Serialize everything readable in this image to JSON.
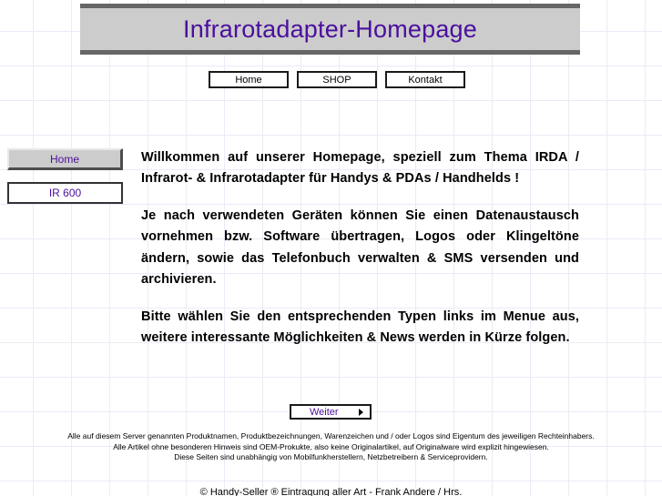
{
  "header": {
    "title": "Infrarotadapter-Homepage",
    "bg_color": "#cccccc",
    "border_color": "#666666",
    "title_color": "#4b0f9e"
  },
  "topnav": {
    "items": [
      {
        "label": "Home"
      },
      {
        "label": "SHOP"
      },
      {
        "label": "Kontakt"
      }
    ]
  },
  "sidebar": {
    "items": [
      {
        "label": "Home",
        "state": "active"
      },
      {
        "label": "IR 600",
        "state": "plain"
      }
    ]
  },
  "main": {
    "paragraphs": [
      "Willkommen auf unserer Homepage, speziell zum Thema IRDA / Infrarot- & Infrarotadapter für Handys & PDAs / Handhelds !",
      "Je nach verwendeten Geräten können Sie einen Datenaustausch vornehmen bzw. Software übertragen, Logos oder Klingeltöne ändern, sowie das Telefonbuch verwalten & SMS versenden und archivieren.",
      "Bitte wählen Sie den entsprechenden Typen links im Menue aus, weitere interessante Möglichkeiten & News werden in Kürze folgen."
    ]
  },
  "weiter": {
    "label": "Weiter",
    "arrow_icon": "triangle-right-icon",
    "label_color": "#4b0f9e"
  },
  "footer": {
    "lines": [
      "Alle auf diesem Server genannten Produktnamen, Produktbezeichnungen, Warenzeichen und / oder Logos sind Eigentum des jeweiligen Rechteinhabers.",
      "Alle Artikel ohne besonderen Hinweis sind OEM-Prokukte, also keine Originalartikel, auf Originalware wird explizit hingewiesen.",
      "Diese Seiten sind unabhängig von Mobilfunkherstellern, Netzbetreibern & Serviceprovidern."
    ],
    "cut_off_line": "© Handy-Seller ® Eintragung aller Art - Frank Andere / Hrs."
  }
}
